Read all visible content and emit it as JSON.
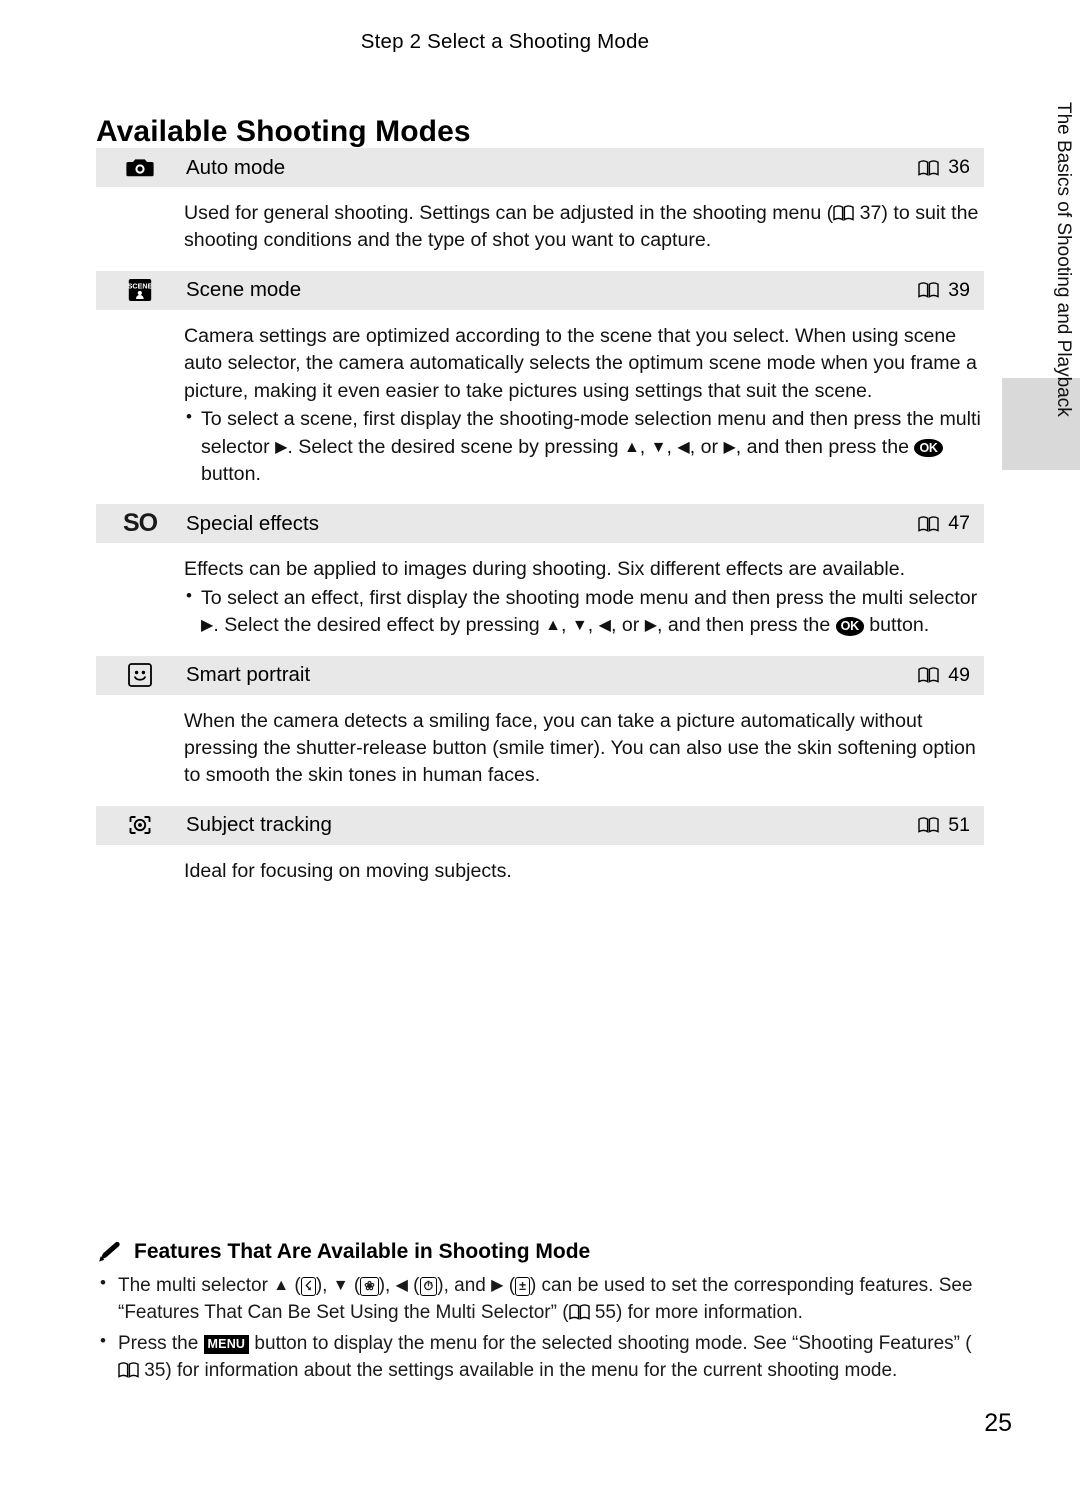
{
  "header": {
    "title": "Step 2 Select a Shooting Mode"
  },
  "page_title": "Available Shooting Modes",
  "side_tab": {
    "text": "The Basics of Shooting and Playback"
  },
  "page_number": "25",
  "modes": [
    {
      "icon": "camera-auto-icon",
      "label": "Auto mode",
      "ref": "36",
      "body": "Used for general shooting. Settings can be adjusted in the shooting menu (A 37) to suit the shooting conditions and the type of shot you want to capture.",
      "body_pre": "Used for general shooting. Settings can be adjusted in the shooting menu (",
      "body_post": "37) to suit the shooting conditions and the type of shot you want to capture.",
      "bullets": []
    },
    {
      "icon": "scene-icon",
      "label": "Scene mode",
      "ref": "39",
      "body": "Camera settings are optimized according to the scene that you select. When using scene auto selector, the camera automatically selects the optimum scene mode when you frame a picture, making it even easier to take pictures using settings that suit the scene.",
      "bullets": [
        {
          "pre": "To select a scene, first display the shooting-mode selection menu and then press the multi selector ",
          "mid": ". Select the desired scene by pressing ",
          "dirs": ", , , or ",
          "post": ", and then press the ",
          "end": " button."
        }
      ]
    },
    {
      "icon": "special-effects-icon",
      "label": "Special effects",
      "ref": "47",
      "body": "Effects can be applied to images during shooting. Six different effects are available.",
      "bullets": [
        {
          "pre": "To select an effect, first display the shooting mode menu and then press the multi selector ",
          "mid": ". Select the desired effect by pressing ",
          "post": ", and then press the ",
          "end": " button."
        }
      ]
    },
    {
      "icon": "smart-portrait-icon",
      "label": "Smart portrait",
      "ref": "49",
      "body": "When the camera detects a smiling face, you can take a picture automatically without pressing the shutter-release button (smile timer). You can also use the skin softening option to smooth the skin tones in human faces.",
      "bullets": []
    },
    {
      "icon": "subject-tracking-icon",
      "label": "Subject tracking",
      "ref": "51",
      "body": "Ideal for focusing on moving subjects.",
      "bullets": []
    }
  ],
  "notes": {
    "title": "Features That Are Available in Shooting Mode",
    "items": [
      {
        "t1": "The multi selector ",
        "t2": " (",
        "t3": "), ",
        "t4": " (",
        "t5": "), ",
        "t6": " (",
        "t7": "), and ",
        "t8": " (",
        "t9": ") can be used to set the corresponding features. See “Features That Can Be Set Using the Multi Selector” (",
        "t10": " 55) for more information."
      },
      {
        "p1": "Press the ",
        "p2": " button to display the menu for the selected shooting mode. See “Shooting Features” (",
        "p3": " 35) for information about the settings available in the menu for the current shooting mode."
      }
    ]
  },
  "glyphs": {
    "ok": "OK",
    "menu": "MENU",
    "up_arrow": "▲",
    "down_arrow": "▼",
    "left_arrow": "◀",
    "right_arrow": "▶",
    "flash": "☇",
    "macro": "❀",
    "timer": "⏱",
    "exposure": "±"
  }
}
